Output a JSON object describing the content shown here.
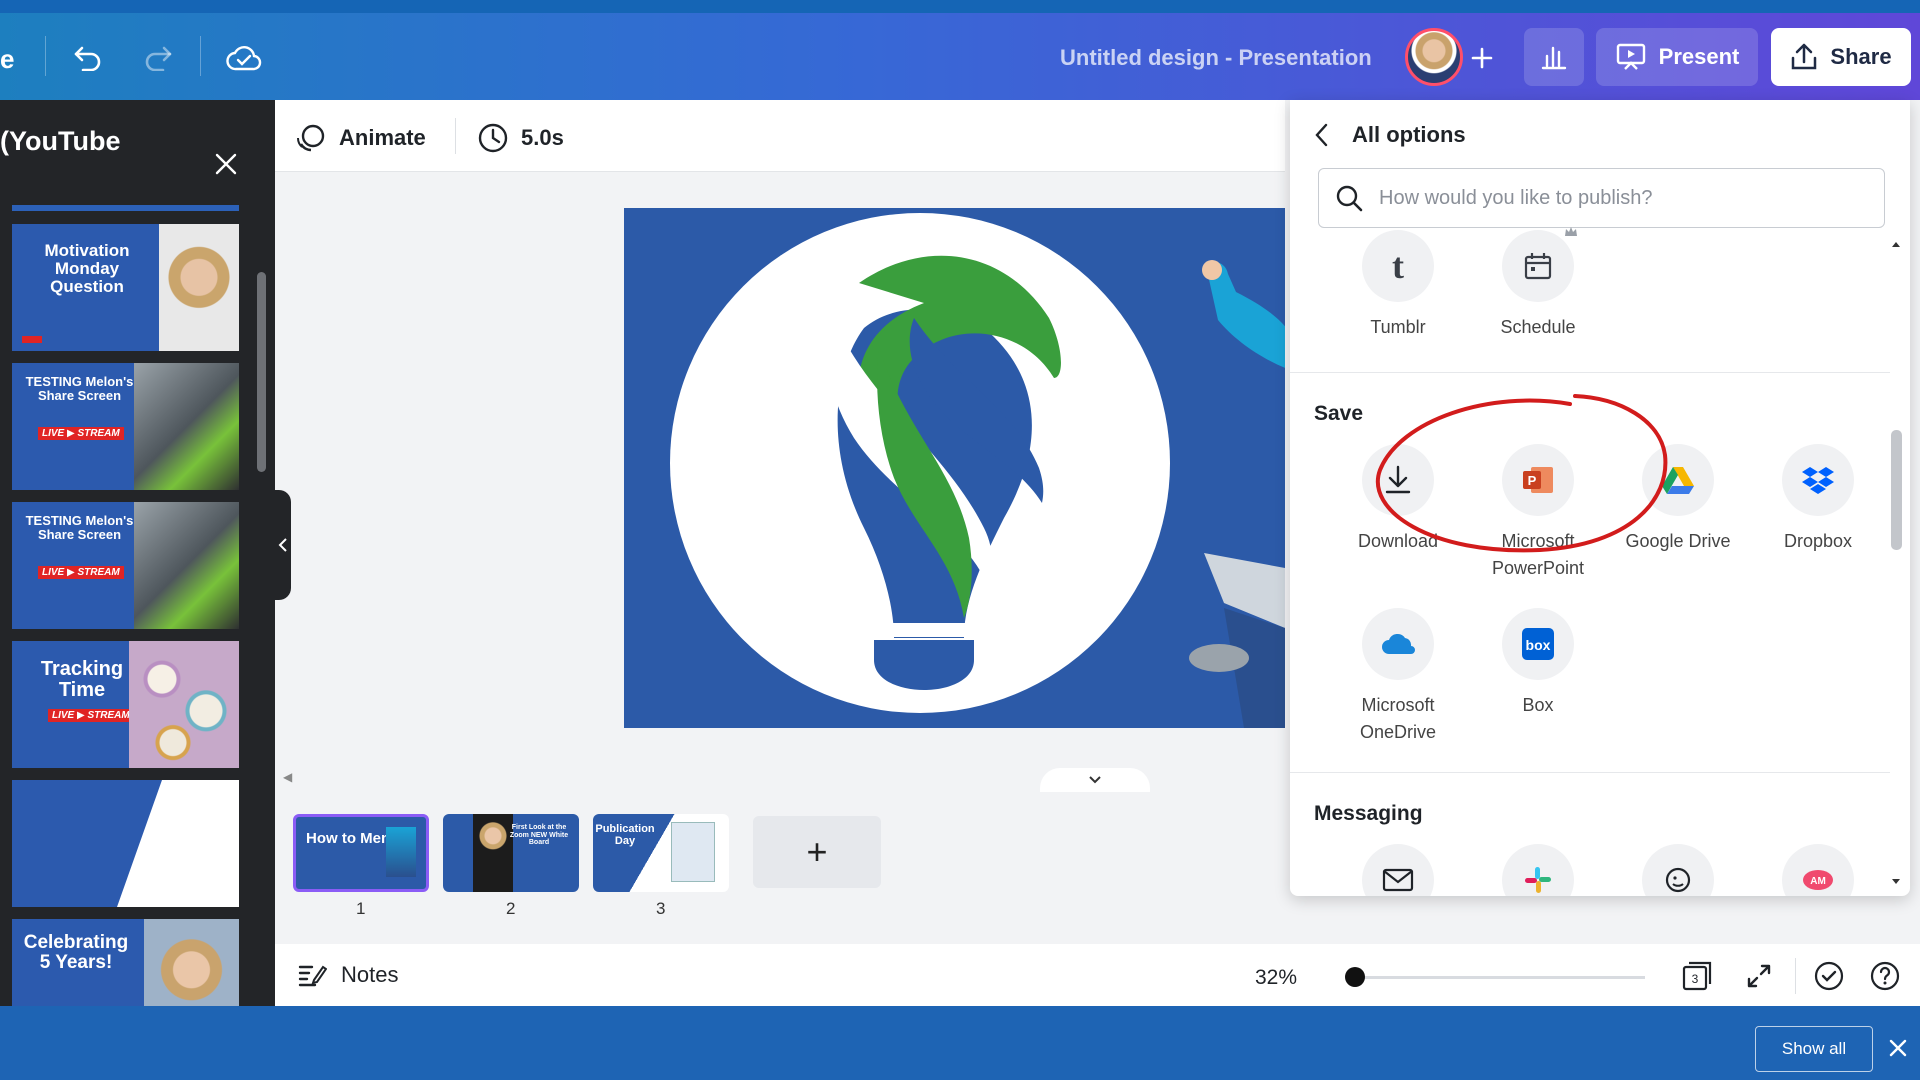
{
  "topbar": {
    "partial_left": "e",
    "doc_title": "Untitled design - Presentation",
    "present_label": "Present",
    "share_label": "Share"
  },
  "sidebar": {
    "title": "(YouTube",
    "thumbnails": [
      {
        "title": "Motivation Monday Question",
        "badge": ""
      },
      {
        "title": "TESTING Melon's Share Screen",
        "badge": "LIVE ▶ STREAM"
      },
      {
        "title": "TESTING Melon's Share Screen",
        "badge": "LIVE ▶ STREAM"
      },
      {
        "title": "Tracking Time",
        "badge": "LIVE ▶ STREAM"
      },
      {
        "title": "",
        "badge": ""
      },
      {
        "title": "Celebrating 5 Years!",
        "badge": ""
      }
    ]
  },
  "toolbar": {
    "animate_label": "Animate",
    "duration_label": "5.0s"
  },
  "pages": {
    "items": [
      {
        "num": "1",
        "title": "How to Menti"
      },
      {
        "num": "2",
        "title": "First Look at the Zoom NEW White Board"
      },
      {
        "num": "3",
        "title": "Publication Day"
      }
    ],
    "add_label": "+"
  },
  "bottom": {
    "notes_label": "Notes",
    "zoom": "32%",
    "zoom_fraction": 0.0,
    "page_count": "3"
  },
  "panel": {
    "back_title": "All options",
    "search_placeholder": "How would you like to publish?",
    "top_row": [
      {
        "label": "Tumblr"
      },
      {
        "label": "Schedule"
      }
    ],
    "save_section": "Save",
    "save_options": [
      {
        "label": "Download"
      },
      {
        "label": "Microsoft PowerPoint"
      },
      {
        "label": "Google Drive"
      },
      {
        "label": "Dropbox"
      },
      {
        "label": "Microsoft OneDrive"
      },
      {
        "label": "Box"
      }
    ],
    "messaging_section": "Messaging"
  },
  "notification": {
    "show_all_label": "Show all"
  },
  "colors": {
    "brand_blue": "#2c5aa8",
    "accent_green": "#3aa33e",
    "annotation_red": "#d21c1c"
  }
}
